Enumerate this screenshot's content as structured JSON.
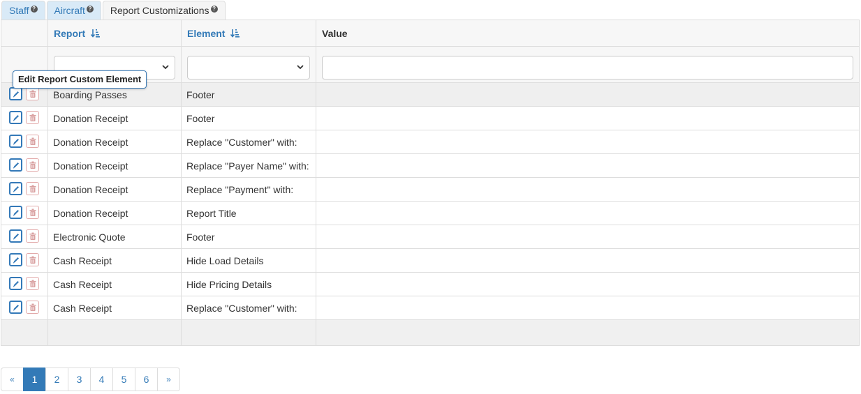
{
  "tabs": [
    {
      "label": "Staff"
    },
    {
      "label": "Aircraft"
    },
    {
      "label": "Report Customizations"
    }
  ],
  "columns": {
    "report": "Report",
    "element": "Element",
    "value": "Value"
  },
  "tooltip": "Edit Report Custom Element",
  "rows": [
    {
      "report": "Boarding Passes",
      "element": "Footer",
      "value": ""
    },
    {
      "report": "Donation Receipt",
      "element": "Footer",
      "value": ""
    },
    {
      "report": "Donation Receipt",
      "element": "Replace \"Customer\" with:",
      "value": ""
    },
    {
      "report": "Donation Receipt",
      "element": "Replace \"Payer Name\" with:",
      "value": ""
    },
    {
      "report": "Donation Receipt",
      "element": "Replace \"Payment\" with:",
      "value": ""
    },
    {
      "report": "Donation Receipt",
      "element": "Report Title",
      "value": ""
    },
    {
      "report": "Electronic Quote",
      "element": "Footer",
      "value": ""
    },
    {
      "report": "Cash Receipt",
      "element": "Hide Load Details",
      "value": ""
    },
    {
      "report": "Cash Receipt",
      "element": "Hide Pricing Details",
      "value": ""
    },
    {
      "report": "Cash Receipt",
      "element": "Replace \"Customer\" with:",
      "value": ""
    }
  ],
  "pagination": {
    "prev": "«",
    "pages": [
      "1",
      "2",
      "3",
      "4",
      "5",
      "6"
    ],
    "next": "»",
    "current": "1"
  },
  "colors": {
    "accent": "#337ab7",
    "delete": "#d9a0a0"
  }
}
